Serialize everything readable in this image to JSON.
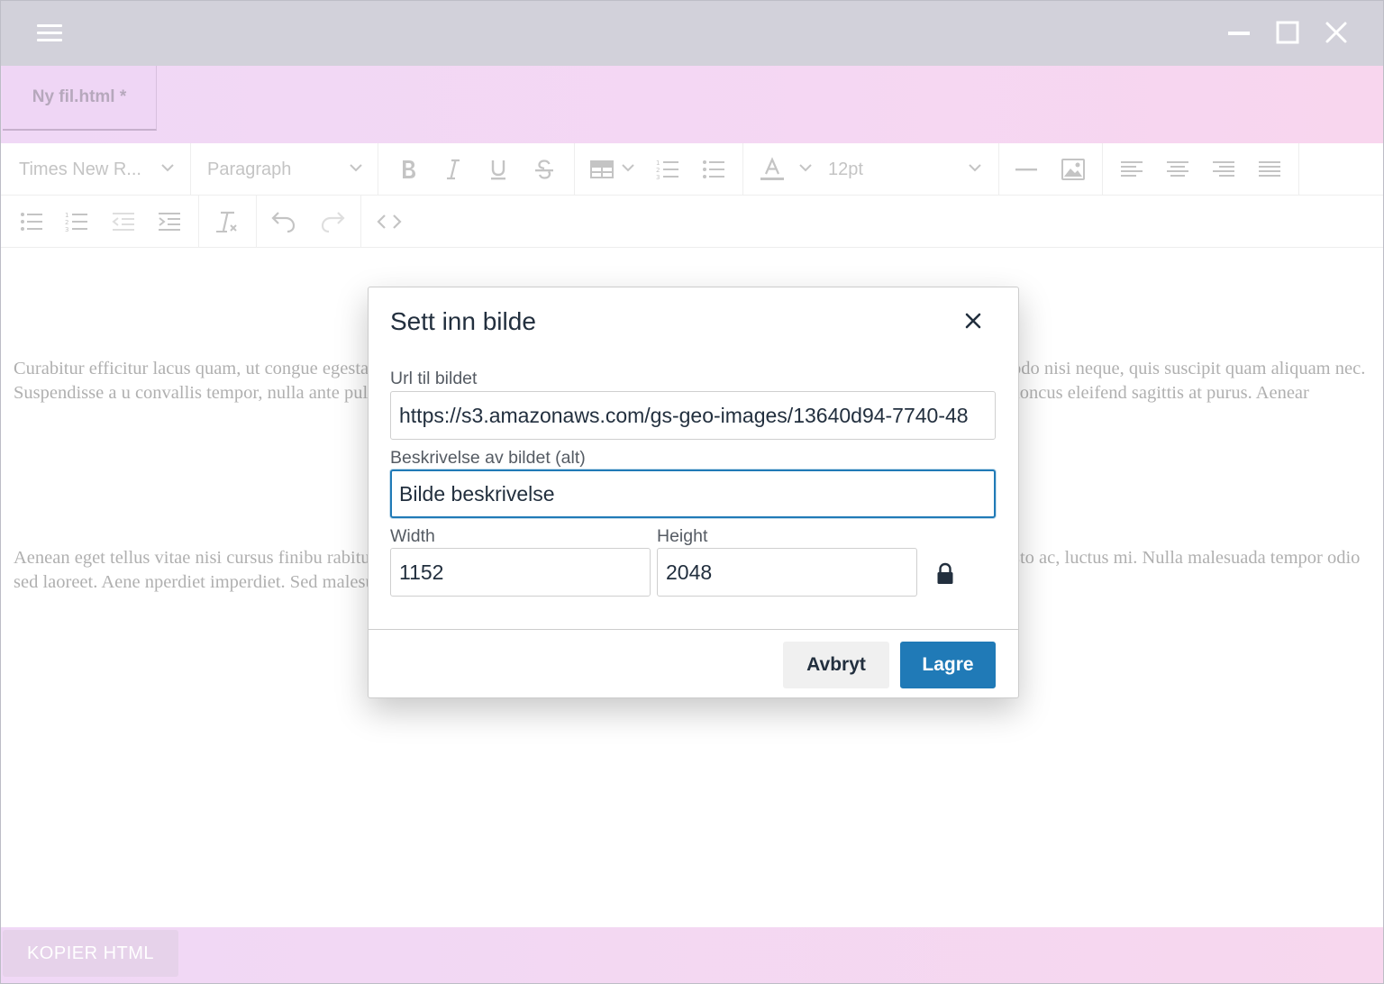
{
  "window": {
    "tab_label": "Ny fil.html *"
  },
  "toolbar": {
    "font_family": "Times New R...",
    "block_format": "Paragraph",
    "font_size": "12pt"
  },
  "content": {
    "paragraph1": "Curabitur efficitur lacus quam, ut congue                                                                                                                                                                  egestas magna in, imperdiet ligula. Praesent rutrum purus at nulla bibendum                                                                                                                                       n. Integer commodo nisi neque, quis suscipit quam aliquam nec. Suspendisse a                                                                                                                                    u convallis tempor, nulla ante pulvinar velit, vel condimentum ipsum sapien sit a                                                                                                                                   quam commodo. Proin in ex vitae leo rhoncus eleifend sagittis at purus. Aenear",
    "paragraph2": "Aenean eget tellus vitae nisi cursus finibu                                                                                                                                                                  rabitur diam felis, congue sit amet ligula nec, blandit commodo sem. Proin ultricie                                                                                                                                   semper justo ac, luctus mi. Nulla malesuada tempor odio sed laoreet. Aene                                                                                                                                       nperdiet imperdiet. Sed malesuada ut lorem sed pharetra. Vivamus vel aliquam"
  },
  "dialog": {
    "title": "Sett inn bilde",
    "url_label": "Url til bildet",
    "url_value": "https://s3.amazonaws.com/gs-geo-images/13640d94-7740-48",
    "alt_label": "Beskrivelse av bildet (alt)",
    "alt_value": "Bilde beskrivelse",
    "width_label": "Width",
    "width_value": "1152",
    "height_label": "Height",
    "height_value": "2048",
    "cancel_label": "Avbryt",
    "save_label": "Lagre"
  },
  "footer": {
    "copy_label": "KOPIER HTML"
  },
  "colors": {
    "primary": "#207ab7",
    "title_text": "#222f3e",
    "titlebar": "#d2d1da",
    "tabbar": "#f3d8f4"
  }
}
